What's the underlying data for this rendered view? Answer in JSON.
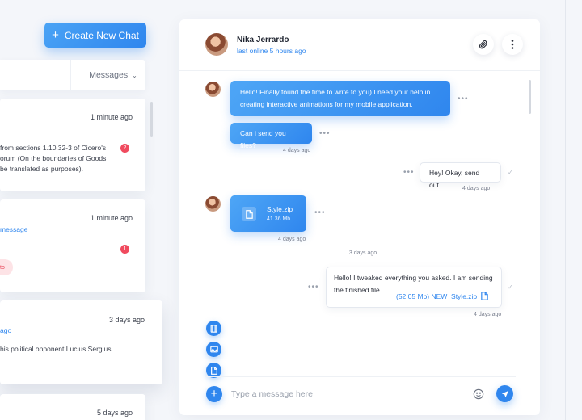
{
  "sidebar": {
    "create_chat_label": "Create New Chat",
    "filter_label": "Messages",
    "conversations": [
      {
        "time": "1 minute ago",
        "preview_lines": [
          "from sections 1.10.32-3 of Cicero's",
          "orum (On the boundaries of Goods",
          "be translated as purposes)."
        ],
        "unread": "2"
      },
      {
        "time": "1 minute ago",
        "link_text": "message",
        "unread": "1",
        "tag": "to"
      },
      {
        "time": "3 days ago",
        "link_text": "ago",
        "preview_lines": [
          "his political opponent Lucius Sergius"
        ]
      },
      {
        "time": "5 days ago"
      }
    ]
  },
  "chat": {
    "contact_name": "Nika Jerrardo",
    "contact_status": "last online 5 hours ago",
    "messages": [
      {
        "direction": "incoming",
        "lines": [
          "Hello! Finally found the time to write to you) I need your help in",
          "creating interactive animations for my mobile application."
        ]
      },
      {
        "direction": "incoming",
        "text": "Can i send you files?",
        "time": "4 days ago"
      },
      {
        "direction": "outgoing",
        "text": "Hey! Okay, send out.",
        "time": "4 days ago"
      },
      {
        "direction": "incoming",
        "file_name": "Style.zip",
        "file_size": "41.36 Mb",
        "time": "4 days ago"
      },
      {
        "direction": "outgoing",
        "lines": [
          "Hello! I tweaked everything you asked. I am sending",
          "the finished file."
        ],
        "attachment": "(52.05 Mb) NEW_Style.zip",
        "time": "4 days ago"
      }
    ],
    "day_separator": "3 days ago",
    "input_placeholder": "Type a message here"
  },
  "colors": {
    "accent": "#2f86ee",
    "badge": "#f04a5e",
    "background": "#f4f6fa"
  },
  "icons": [
    "plus-icon",
    "chevron-down-icon",
    "paperclip-icon",
    "more-vertical-icon",
    "file-icon",
    "video-icon",
    "image-icon",
    "document-icon",
    "emoji-icon",
    "send-icon",
    "check-icon"
  ]
}
